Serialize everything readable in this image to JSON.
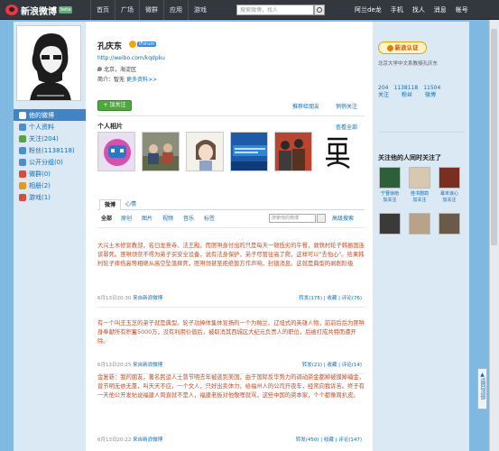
{
  "topbar": {
    "logo": "新浪微博",
    "beta": "beta",
    "nav": [
      "首页",
      "广场",
      "微群",
      "应用",
      "游戏"
    ],
    "search_placeholder": "搜索微博，找人",
    "user_links": [
      "阿兰de龙",
      "手机",
      "找人",
      "消息",
      "帐号"
    ]
  },
  "sidebar": {
    "items": [
      {
        "label": "他的微博",
        "icon": "weibo-icon",
        "color": "#3f85c6"
      },
      {
        "label": "个人资料",
        "icon": "profile-icon",
        "color": "#4a90d0"
      },
      {
        "label": "关注(204)",
        "icon": "follow-icon",
        "color": "#56a33f"
      },
      {
        "label": "粉丝(1138118)",
        "icon": "fans-icon",
        "color": "#4a90d0"
      },
      {
        "label": "公开分组(0)",
        "icon": "group-icon",
        "color": "#4a90d0"
      },
      {
        "label": "微群(0)",
        "icon": "weiqun-icon",
        "color": "#d94b3a"
      },
      {
        "label": "相册(2)",
        "icon": "album-icon",
        "color": "#e09a20"
      },
      {
        "label": "游戏(1)",
        "icon": "game-icon",
        "color": "#d94b3a"
      }
    ]
  },
  "profile": {
    "name": "孔庆东",
    "v_tag": "iForum",
    "url": "http://weibo.com/kqdpku",
    "location": "北京，海淀区",
    "bio_prefix": "简介：",
    "bio": "智无",
    "bio_more": "更多资料>>",
    "follow_label": "+ 加关注",
    "recommend_label": "推荐给朋友",
    "cancel_label": "悄悄关注"
  },
  "photos": {
    "title": "个人相片",
    "all_link": "查看全部"
  },
  "tabs": {
    "items": [
      "微博",
      "心情"
    ],
    "filters": [
      "全部",
      "原创",
      "图片",
      "视频",
      "音乐",
      "标签"
    ],
    "search_placeholder": "搜索他的微博",
    "advanced": "高级搜索"
  },
  "posts": [
    {
      "text": "大兴土木修宣教部，名曰龙意寺、法王殿。而匪哄身付出的只是每天一顿低劣的午餐，敦轶村轮子韩振国连该罪死。匪哄领奈不得为弟子买安全设备，说有法身保护，弟子尽管往高了爬，这样可以\"去怕心\"。结果韩村轮子摔伤高等相继从高空坠落摔死，匪哄领甚至拒绝暂方作声响，封锁消息。这就是典型的剥削阶级",
      "time": "6月13日20:30",
      "source": "来自新浪微博",
      "actions": "转发(175) | 收藏 | 评论(76)"
    },
    {
      "text": "有一个叫王玉芝的弟子就是典型。轮子功捧体集体宣扬的一个为贼兰、辽坦式的英雄人物，前前后后为匪哄身奉献所有积蓄5000万，没有利用价值后，被取消其西城区大纪元负责人的职位，后被打成共特而遭开除。",
      "time": "6月13日20:25",
      "source": "来自新浪微博",
      "actions": "转发(21) | 收藏 | 评论(14)"
    },
    {
      "text": "金复新：我的朋友，著名民运人士曾节明去年被逃到美国，由于国际反华势力的调动资金都掉被摸掉编金，曾节明无依无靠，叫天天不应，一个文人，只好出卖体力，给福州人的公司开夜车，经常向我诉苦。终于有一天他公开发帖说福建人简直就不是人，福建老板对他敬哩就骂，这些中国的资本家，个个都像周扒皮。",
      "time": "6月13日20:22",
      "source": "来自新浪微博",
      "actions": "转发(450) | 收藏 | 评论(147)"
    }
  ],
  "right": {
    "cert_label": "新浪认证",
    "cert_text": "北京大学中文系教授孔庆东",
    "stats_values": [
      "204",
      "1138118",
      "11504"
    ],
    "stats_labels": [
      "关注",
      "粉丝",
      "微博"
    ],
    "common_title": "关注他的人同时关注了",
    "friends_row1": [
      "宁晋徐南",
      "桂书鹦鹉",
      "幕末浪心"
    ],
    "friends_row1_sub": [
      "加关注",
      "加关注",
      "加关注"
    ]
  },
  "back_to_top": "返回顶部"
}
